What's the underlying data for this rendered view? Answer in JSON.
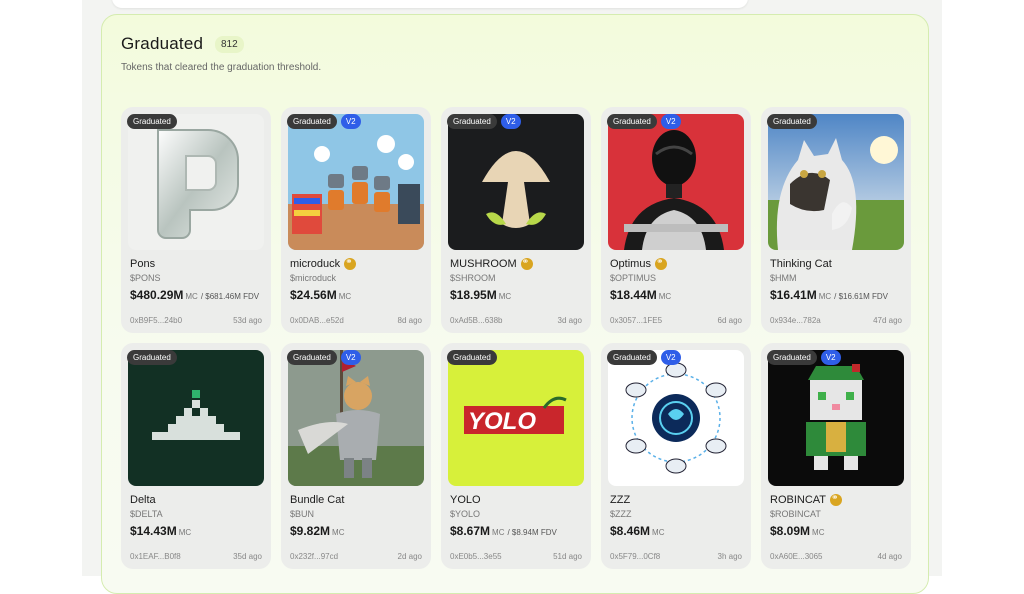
{
  "section": {
    "title": "Graduated",
    "count": "812",
    "subtitle": "Tokens that cleared the graduation threshold."
  },
  "badges": {
    "graduated": "Graduated",
    "v2": "V2"
  },
  "colors": {
    "accent": "#2f5ee8",
    "badge_dark": "#3a3a3a",
    "verified": "#d9a520",
    "section_border": "#d5ecb0"
  },
  "tokens": [
    {
      "name": "Pons",
      "ticker": "$PONS",
      "mc": "$480.29M",
      "mc_unit": "MC",
      "fdv": "/ $681.46M FDV",
      "address": "0xB9F5...24b0",
      "age": "53d ago",
      "v2": false,
      "verified": false,
      "image": "chrome-letter-p"
    },
    {
      "name": "microduck",
      "ticker": "$microduck",
      "mc": "$24.56M",
      "mc_unit": "MC",
      "fdv": "",
      "address": "0x0DAB...e52d",
      "age": "8d ago",
      "v2": true,
      "verified": true,
      "image": "comic-robots"
    },
    {
      "name": "MUSHROOM",
      "ticker": "$SHROOM",
      "mc": "$18.95M",
      "mc_unit": "MC",
      "fdv": "",
      "address": "0xAd5B...638b",
      "age": "3d ago",
      "v2": true,
      "verified": true,
      "image": "mushroom"
    },
    {
      "name": "Optimus",
      "ticker": "$OPTIMUS",
      "mc": "$18.44M",
      "mc_unit": "MC",
      "fdv": "",
      "address": "0x3057...1FE5",
      "age": "6d ago",
      "v2": true,
      "verified": true,
      "image": "robot"
    },
    {
      "name": "Thinking Cat",
      "ticker": "$HMM",
      "mc": "$16.41M",
      "mc_unit": "MC",
      "fdv": "/ $16.61M FDV",
      "address": "0x934e...782a",
      "age": "47d ago",
      "v2": false,
      "verified": false,
      "image": "thinking-cat"
    },
    {
      "name": "Delta",
      "ticker": "$DELTA",
      "mc": "$14.43M",
      "mc_unit": "MC",
      "fdv": "",
      "address": "0x1EAF...B0f8",
      "age": "35d ago",
      "v2": false,
      "verified": false,
      "image": "pyramid-blocks"
    },
    {
      "name": "Bundle Cat",
      "ticker": "$BUN",
      "mc": "$9.82M",
      "mc_unit": "MC",
      "fdv": "",
      "address": "0x232f...97cd",
      "age": "2d ago",
      "v2": true,
      "verified": false,
      "image": "knight-cat"
    },
    {
      "name": "YOLO",
      "ticker": "$YOLO",
      "mc": "$8.67M",
      "mc_unit": "MC",
      "fdv": "/ $8.94M FDV",
      "address": "0xE0b5...3e55",
      "age": "51d ago",
      "v2": false,
      "verified": false,
      "image": "yolo-logo"
    },
    {
      "name": "ZZZ",
      "ticker": "$ZZZ",
      "mc": "$8.46M",
      "mc_unit": "MC",
      "fdv": "",
      "address": "0x5F79...0Cf8",
      "age": "3h ago",
      "v2": true,
      "verified": false,
      "image": "brain-network"
    },
    {
      "name": "ROBINCAT",
      "ticker": "$ROBINCAT",
      "mc": "$8.09M",
      "mc_unit": "MC",
      "fdv": "",
      "address": "0xA60E...3065",
      "age": "4d ago",
      "v2": true,
      "verified": true,
      "image": "pixel-cat"
    }
  ]
}
